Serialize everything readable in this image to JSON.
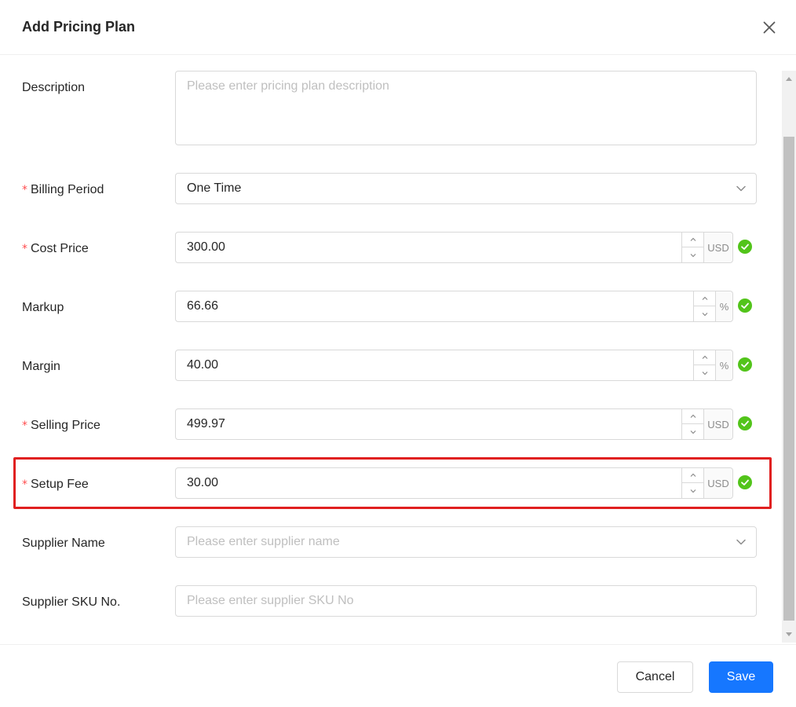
{
  "modal": {
    "title": "Add Pricing Plan"
  },
  "form": {
    "description": {
      "label": "Description",
      "placeholder": "Please enter pricing plan description",
      "value": ""
    },
    "billing_period": {
      "required_mark": "*",
      "label": "Billing Period",
      "value": "One Time"
    },
    "cost_price": {
      "required_mark": "*",
      "label": "Cost Price",
      "value": "300.00",
      "unit": "USD"
    },
    "markup": {
      "label": "Markup",
      "value": "66.66",
      "unit": "%"
    },
    "margin": {
      "label": "Margin",
      "value": "40.00",
      "unit": "%"
    },
    "selling_price": {
      "required_mark": "*",
      "label": "Selling Price",
      "value": "499.97",
      "unit": "USD"
    },
    "setup_fee": {
      "required_mark": "*",
      "label": "Setup Fee",
      "value": "30.00",
      "unit": "USD"
    },
    "supplier_name": {
      "label": "Supplier Name",
      "placeholder": "Please enter supplier name",
      "value": ""
    },
    "supplier_sku": {
      "label": "Supplier SKU No.",
      "placeholder": "Please enter supplier SKU No",
      "value": ""
    }
  },
  "footer": {
    "cancel_label": "Cancel",
    "save_label": "Save"
  },
  "colors": {
    "primary": "#1677ff",
    "success": "#52c41a",
    "required": "#ff4d4f",
    "highlight": "#e02020"
  },
  "icons": {
    "close": "close-icon",
    "dropdown": "chevron-down-icon",
    "increment": "chevron-up-icon",
    "decrement": "chevron-down-icon",
    "valid": "check-circle-icon"
  }
}
